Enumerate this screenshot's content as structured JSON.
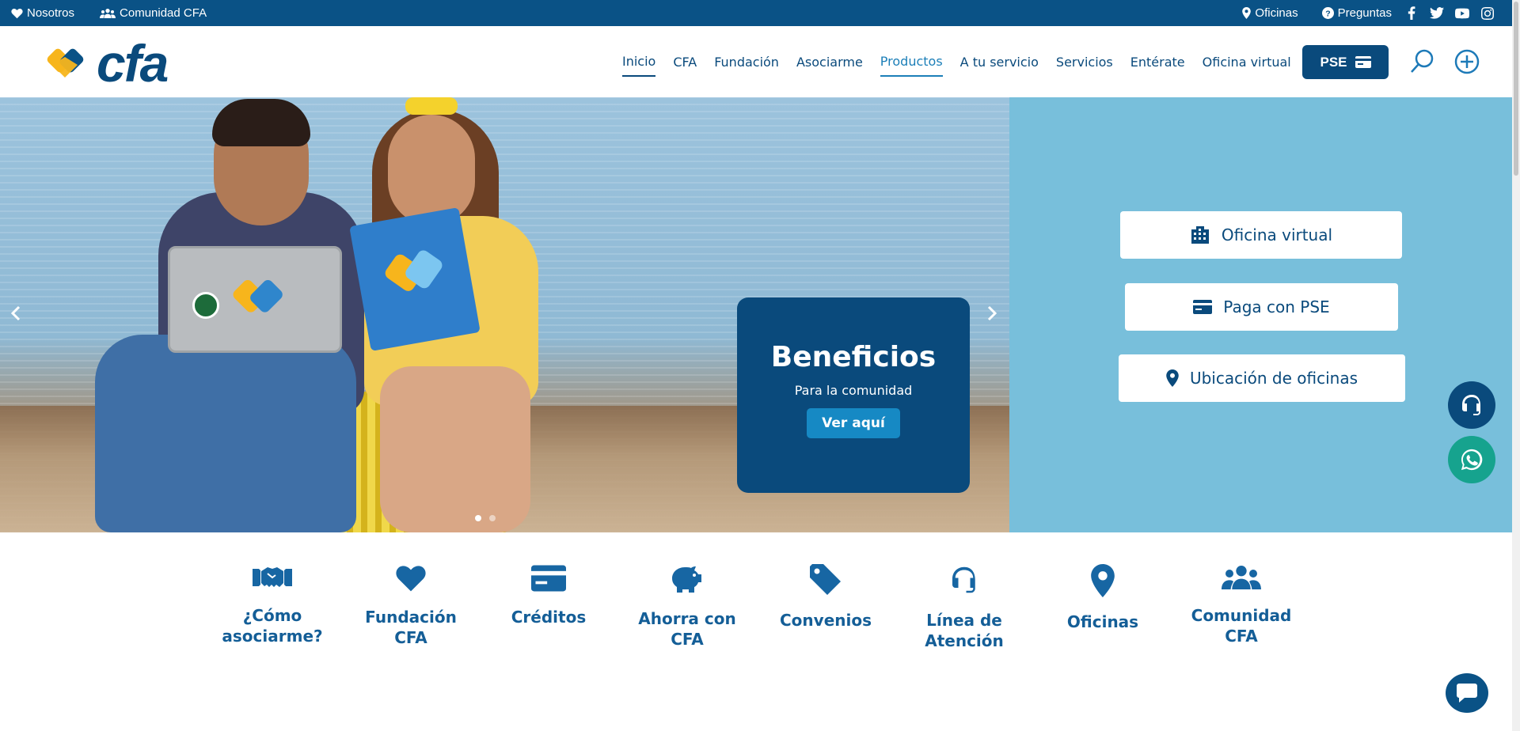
{
  "topbar": {
    "nosotros": "Nosotros",
    "comunidad": "Comunidad CFA",
    "oficinas": "Oficinas",
    "preguntas": "Preguntas"
  },
  "brand": {
    "name": "cfa",
    "yellow": "#f7b51c",
    "blue": "#0a4a7c",
    "light_blue": "#78bfdb"
  },
  "nav": {
    "items": [
      "Inicio",
      "CFA",
      "Fundación",
      "Asociarme",
      "Productos",
      "A tu servicio",
      "Servicios",
      "Entérate",
      "Oficina virtual"
    ],
    "pse": "PSE"
  },
  "hero": {
    "card_title": "Beneficios",
    "card_subtitle": "Para la comunidad",
    "card_cta": "Ver aquí"
  },
  "side": {
    "oficina_virtual": "Oficina virtual",
    "paga_pse": "Paga con PSE",
    "ubicacion": "Ubicación de oficinas"
  },
  "quick_links": [
    {
      "label": "¿Cómo asociarme?",
      "icon": "handshake-icon"
    },
    {
      "label": "Fundación CFA",
      "icon": "heart-icon"
    },
    {
      "label": "Créditos",
      "icon": "credit-card-icon"
    },
    {
      "label": "Ahorra con CFA",
      "icon": "piggy-bank-icon"
    },
    {
      "label": "Convenios",
      "icon": "tag-icon"
    },
    {
      "label": "Línea de Atención",
      "icon": "headset-icon"
    },
    {
      "label": "Oficinas",
      "icon": "map-pin-icon"
    },
    {
      "label": "Comunidad CFA",
      "icon": "users-icon"
    }
  ]
}
